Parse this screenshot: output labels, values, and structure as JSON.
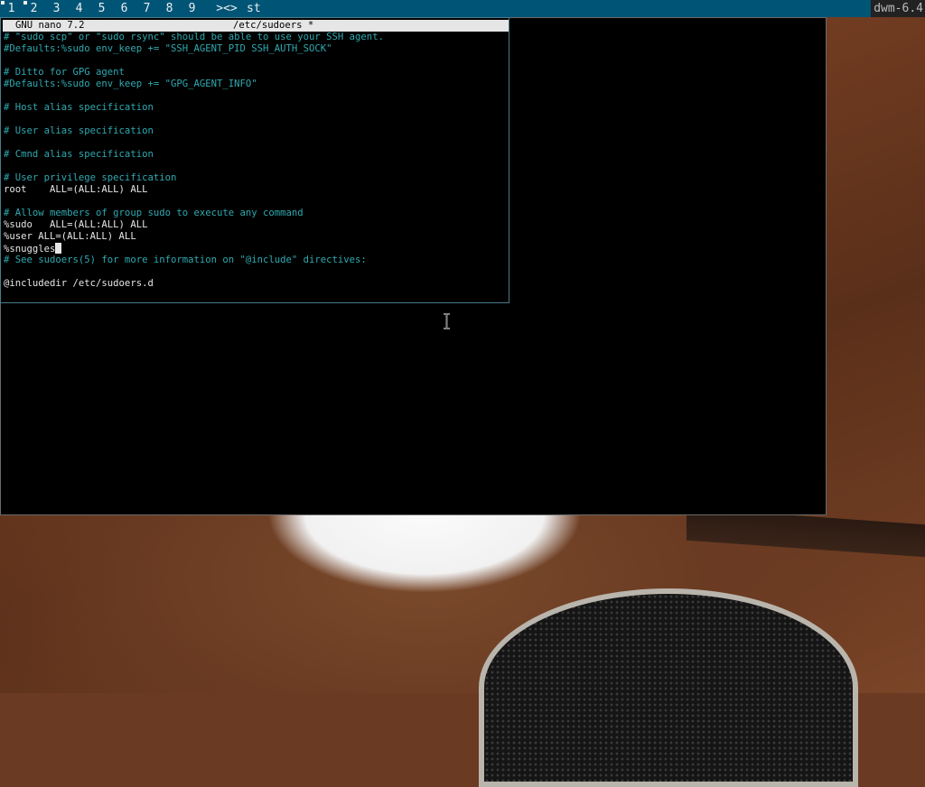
{
  "bar": {
    "tags": [
      "1",
      "2",
      "3",
      "4",
      "5",
      "6",
      "7",
      "8",
      "9"
    ],
    "layout_symbol": "><>",
    "window_title": "st",
    "status": "dwm-6.4"
  },
  "nano": {
    "title_left": "GNU nano 7.2",
    "title_center": "/etc/sudoers *",
    "lines": [
      {
        "text": "# \"sudo scp\" or \"sudo rsync\" should be able to use your SSH agent.",
        "kind": "comment"
      },
      {
        "text": "#Defaults:%sudo env_keep += \"SSH_AGENT_PID SSH_AUTH_SOCK\"",
        "kind": "comment"
      },
      {
        "text": "",
        "kind": "blank"
      },
      {
        "text": "# Ditto for GPG agent",
        "kind": "comment"
      },
      {
        "text": "#Defaults:%sudo env_keep += \"GPG_AGENT_INFO\"",
        "kind": "comment"
      },
      {
        "text": "",
        "kind": "blank"
      },
      {
        "text": "# Host alias specification",
        "kind": "comment"
      },
      {
        "text": "",
        "kind": "blank"
      },
      {
        "text": "# User alias specification",
        "kind": "comment"
      },
      {
        "text": "",
        "kind": "blank"
      },
      {
        "text": "# Cmnd alias specification",
        "kind": "comment"
      },
      {
        "text": "",
        "kind": "blank"
      },
      {
        "text": "# User privilege specification",
        "kind": "comment"
      },
      {
        "text": "root    ALL=(ALL:ALL) ALL",
        "kind": "text"
      },
      {
        "text": "",
        "kind": "blank"
      },
      {
        "text": "# Allow members of group sudo to execute any command",
        "kind": "comment"
      },
      {
        "text": "%sudo   ALL=(ALL:ALL) ALL",
        "kind": "text"
      },
      {
        "text": "%user ALL=(ALL:ALL) ALL",
        "kind": "text"
      },
      {
        "text": "%snuggles",
        "kind": "cursor"
      },
      {
        "text": "# See sudoers(5) for more information on \"@include\" directives:",
        "kind": "comment"
      },
      {
        "text": "",
        "kind": "blank"
      },
      {
        "text": "@includedir /etc/sudoers.d",
        "kind": "text"
      }
    ]
  },
  "colors": {
    "bar_bg": "#005577",
    "comment": "#2fa9b0",
    "status_bg": "#222222"
  },
  "icons": {
    "pointer": "ibeam-cursor-icon"
  }
}
